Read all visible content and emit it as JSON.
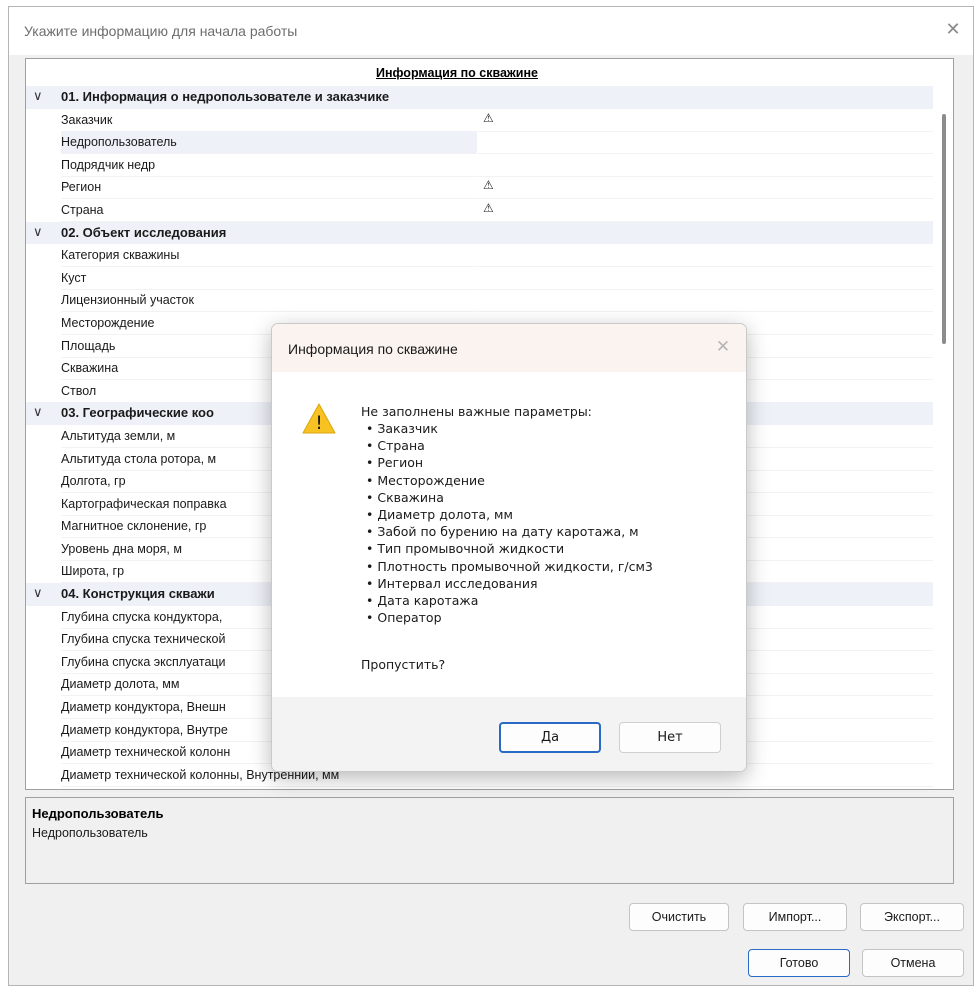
{
  "window": {
    "title": "Укажите информацию для начала работы",
    "close_glyph": "✕"
  },
  "grid": {
    "header": "Информация по скважине",
    "rows": [
      {
        "type": "category",
        "label": "01. Информация о недропользователе и заказчике"
      },
      {
        "type": "prop",
        "label": "Заказчик",
        "warning": true
      },
      {
        "type": "prop",
        "label": "Недропользователь",
        "selected": true
      },
      {
        "type": "prop",
        "label": "Подрядчик недр"
      },
      {
        "type": "prop",
        "label": "Регион",
        "warning": true
      },
      {
        "type": "prop",
        "label": "Страна",
        "warning": true
      },
      {
        "type": "category",
        "label": "02. Объект исследования"
      },
      {
        "type": "prop",
        "label": "Категория скважины"
      },
      {
        "type": "prop",
        "label": "Куст"
      },
      {
        "type": "prop",
        "label": "Лицензионный участок"
      },
      {
        "type": "prop",
        "label": "Месторождение"
      },
      {
        "type": "prop",
        "label": "Площадь"
      },
      {
        "type": "prop",
        "label": "Скважина"
      },
      {
        "type": "prop",
        "label": "Ствол"
      },
      {
        "type": "category",
        "label": "03. Географические коо"
      },
      {
        "type": "prop",
        "label": "Альтитуда земли, м"
      },
      {
        "type": "prop",
        "label": "Альтитуда стола ротора, м"
      },
      {
        "type": "prop",
        "label": "Долгота, гр"
      },
      {
        "type": "prop",
        "label": "Картографическая поправка"
      },
      {
        "type": "prop",
        "label": "Магнитное склонение, гр"
      },
      {
        "type": "prop",
        "label": "Уровень дна моря, м"
      },
      {
        "type": "prop",
        "label": "Широта, гр"
      },
      {
        "type": "category",
        "label": "04. Конструкция скважи"
      },
      {
        "type": "prop",
        "label": "Глубина спуска кондуктора,"
      },
      {
        "type": "prop",
        "label": "Глубина спуска технической"
      },
      {
        "type": "prop",
        "label": "Глубина спуска эксплуатаци"
      },
      {
        "type": "prop",
        "label": "Диаметр долота, мм"
      },
      {
        "type": "prop",
        "label": "Диаметр кондуктора, Внешн"
      },
      {
        "type": "prop",
        "label": "Диаметр кондуктора, Внутре"
      },
      {
        "type": "prop",
        "label": "Диаметр технической колонн"
      },
      {
        "type": "prop",
        "label": "Диаметр технической колонны, Внутренний, мм"
      }
    ],
    "chevron_glyph": "∨",
    "warning_glyph": "⚠"
  },
  "description": {
    "title": "Недропользователь",
    "text": "Недропользователь"
  },
  "buttons": {
    "clear": "Очистить",
    "import": "Импорт...",
    "export": "Экспорт...",
    "done": "Готово",
    "cancel": "Отмена"
  },
  "modal": {
    "title": "Информация по скважине",
    "close_glyph": "✕",
    "heading": "Не заполнены важные параметры:",
    "items": [
      "Заказчик",
      "Страна",
      "Регион",
      "Месторождение",
      "Скважина",
      "Диаметр долота, мм",
      "Забой по бурению на дату каротажа, м",
      "Тип промывочной жидкости",
      "Плотность промывочной жидкости, г/см3",
      "Интервал исследования",
      "Дата каротажа",
      "Оператор"
    ],
    "question": "Пропустить?",
    "yes": "Да",
    "no": "Нет",
    "warn_glyph": "!"
  },
  "colors": {
    "accent": "#2a69c6",
    "warning_yellow": "#f8c322",
    "category_bg": "#eef1f8"
  }
}
